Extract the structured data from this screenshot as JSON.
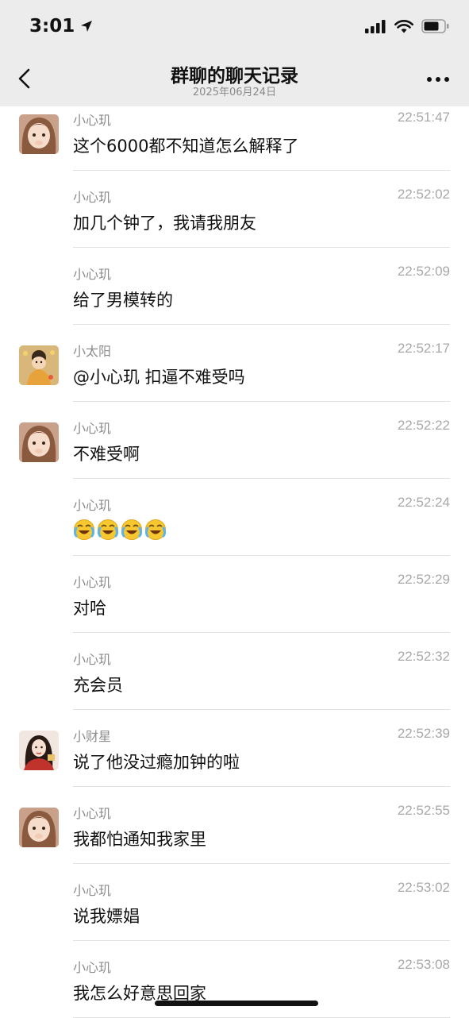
{
  "status": {
    "time": "3:01"
  },
  "nav": {
    "title": "群聊的聊天记录",
    "subtitle": "2025年06月24日"
  },
  "messages": [
    {
      "sender": "小心玑",
      "time": "22:51:47",
      "text": "这个6000都不知道怎么解释了",
      "avatar": "girl"
    },
    {
      "sender": "小心玑",
      "time": "22:52:02",
      "text": "加几个钟了，我请我朋友",
      "avatar": ""
    },
    {
      "sender": "小心玑",
      "time": "22:52:09",
      "text": "给了男模转的",
      "avatar": ""
    },
    {
      "sender": "小太阳",
      "time": "22:52:17",
      "text": "@小心玑 扣逼不难受吗",
      "avatar": "sun"
    },
    {
      "sender": "小心玑",
      "time": "22:52:22",
      "text": "不难受啊",
      "avatar": "girl"
    },
    {
      "sender": "小心玑",
      "time": "22:52:24",
      "text": "",
      "emoji": [
        "laugh-cry",
        "laugh-cry",
        "laugh-cry",
        "laugh-cry"
      ],
      "avatar": ""
    },
    {
      "sender": "小心玑",
      "time": "22:52:29",
      "text": "对哈",
      "avatar": ""
    },
    {
      "sender": "小心玑",
      "time": "22:52:32",
      "text": "充会员",
      "avatar": ""
    },
    {
      "sender": "小财星",
      "time": "22:52:39",
      "text": "说了他没过瘾加钟的啦",
      "avatar": "star"
    },
    {
      "sender": "小心玑",
      "time": "22:52:55",
      "text": "我都怕通知我家里",
      "avatar": "girl"
    },
    {
      "sender": "小心玑",
      "time": "22:53:02",
      "text": "说我嫖娼",
      "avatar": ""
    },
    {
      "sender": "小心玑",
      "time": "22:53:08",
      "text": "我怎么好意思回家",
      "avatar": ""
    }
  ],
  "colors": {
    "header_bg": "#ececec",
    "divider": "#e2e2e2",
    "meta_text": "#8c8c8c"
  }
}
